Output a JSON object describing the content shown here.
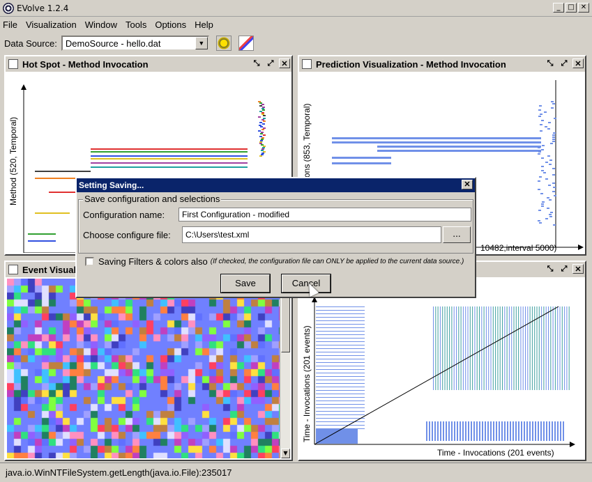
{
  "window": {
    "title": "EVolve 1.2.4",
    "minimize": "_",
    "maximize": "□",
    "close": "✕"
  },
  "menu": [
    "File",
    "Visualization",
    "Window",
    "Tools",
    "Options",
    "Help"
  ],
  "data_source": {
    "label": "Data Source:",
    "selected": "DemoSource - hello.dat",
    "tools": [
      "gear-tool-icon",
      "palette-tool-icon"
    ]
  },
  "frames": {
    "hotspot": {
      "title": "Hot Spot - Method Invocation",
      "y_axis": "Method (520, Temporal)"
    },
    "prediction": {
      "title": "Prediction Visualization - Method Invocation",
      "y_axis": "ons (853, Temporal)",
      "x_axis": "10482,interval 5000)"
    },
    "event": {
      "title": "Event Visuali"
    },
    "scatter": {
      "y_axis": "Time - Invocations (201 events)",
      "x_axis": "Time - Invocations (201 events)"
    }
  },
  "dialog": {
    "title": "Setting Saving...",
    "group_title": "Save configuration and selections",
    "config_name_label": "Configuration name:",
    "config_name_value": "First Configuration - modified",
    "config_file_label": "Choose configure file:",
    "config_file_value": "C:\\Users\\test.xml",
    "browse_label": "...",
    "checkbox_label": "Saving Filters & colors also",
    "checkbox_note": "(If checked, the configuration file can ONLY be applied to  the current data source.)",
    "save_label": "Save",
    "cancel_label": "Cancel",
    "close": "✕"
  },
  "status": "java.io.WinNTFileSystem.getLength(java.io.File):235017",
  "colors": {
    "title_active": "#0a246a",
    "window_bg": "#d4d0c8",
    "plot_blue": "#7090e8"
  }
}
